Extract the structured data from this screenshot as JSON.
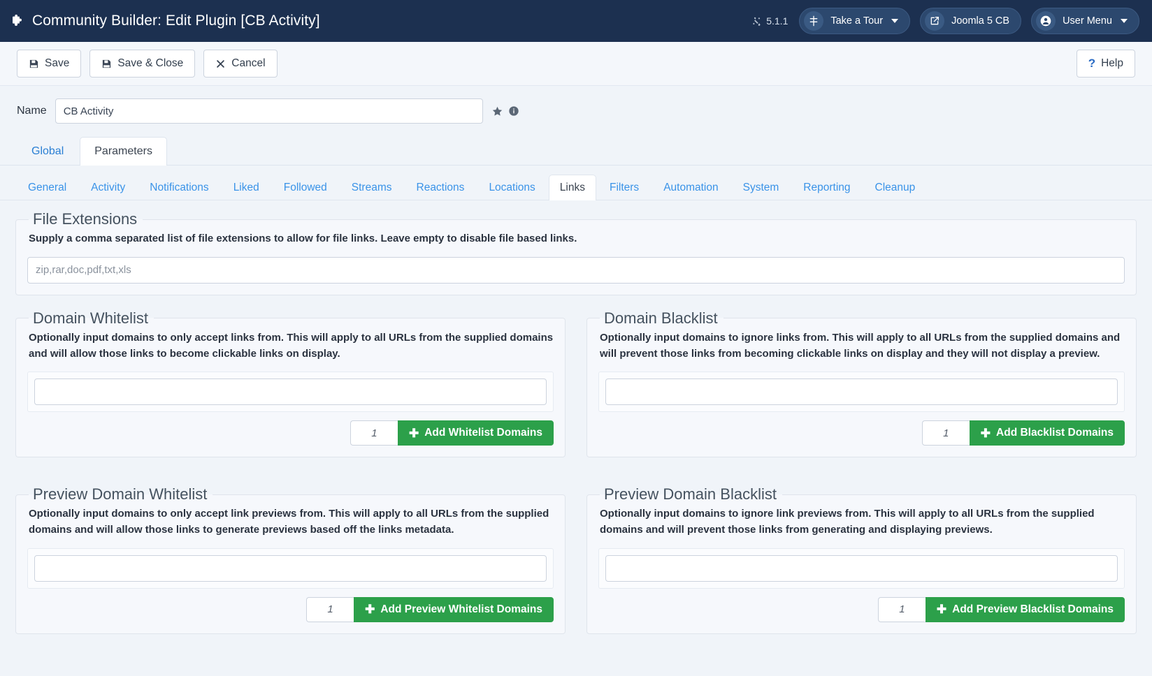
{
  "admin_bar": {
    "title": "Community Builder: Edit Plugin [CB Activity]",
    "joomla_version": "5.1.1",
    "tour_label": "Take a Tour",
    "site_label": "Joomla 5 CB",
    "user_menu_label": "User Menu"
  },
  "toolbar": {
    "save_label": "Save",
    "save_close_label": "Save & Close",
    "cancel_label": "Cancel",
    "help_label": "Help"
  },
  "name_field": {
    "label": "Name",
    "value": "CB Activity",
    "placeholder": "CB Activity"
  },
  "main_tabs": [
    {
      "label": "Global",
      "active": false
    },
    {
      "label": "Parameters",
      "active": true
    }
  ],
  "sub_tabs": [
    {
      "label": "General",
      "active": false
    },
    {
      "label": "Activity",
      "active": false
    },
    {
      "label": "Notifications",
      "active": false
    },
    {
      "label": "Liked",
      "active": false
    },
    {
      "label": "Followed",
      "active": false
    },
    {
      "label": "Streams",
      "active": false
    },
    {
      "label": "Reactions",
      "active": false
    },
    {
      "label": "Locations",
      "active": false
    },
    {
      "label": "Links",
      "active": true
    },
    {
      "label": "Filters",
      "active": false
    },
    {
      "label": "Automation",
      "active": false
    },
    {
      "label": "System",
      "active": false
    },
    {
      "label": "Reporting",
      "active": false
    },
    {
      "label": "Cleanup",
      "active": false
    }
  ],
  "file_extensions": {
    "legend": "File Extensions",
    "description": "Supply a comma separated list of file extensions to allow for file links. Leave empty to disable file based links.",
    "value": "zip,rar,doc,pdf,txt,xls",
    "placeholder": "zip,rar,doc,pdf,txt,xls"
  },
  "domain_whitelist": {
    "legend": "Domain Whitelist",
    "description": "Optionally input domains to only accept links from. This will apply to all URLs from the supplied domains and will allow those links to become clickable links on display.",
    "value": "",
    "count": "1",
    "add_label": "Add Whitelist Domains"
  },
  "domain_blacklist": {
    "legend": "Domain Blacklist",
    "description": "Optionally input domains to ignore links from. This will apply to all URLs from the supplied domains and will prevent those links from becoming clickable links on display and they will not display a preview.",
    "value": "",
    "count": "1",
    "add_label": "Add Blacklist Domains"
  },
  "preview_domain_whitelist": {
    "legend": "Preview Domain Whitelist",
    "description": "Optionally input domains to only accept link previews from. This will apply to all URLs from the supplied domains and will allow those links to generate previews based off the links metadata.",
    "value": "",
    "count": "1",
    "add_label": "Add Preview Whitelist Domains"
  },
  "preview_domain_blacklist": {
    "legend": "Preview Domain Blacklist",
    "description": "Optionally input domains to ignore link previews from. This will apply to all URLs from the supplied domains and will prevent those links from generating and displaying previews.",
    "value": "",
    "count": "1",
    "add_label": "Add Preview Blacklist Domains"
  },
  "colors": {
    "admin_bar": "#1c3050",
    "accent_link": "#3a93e8",
    "add_button_green": "#2ca04a"
  }
}
